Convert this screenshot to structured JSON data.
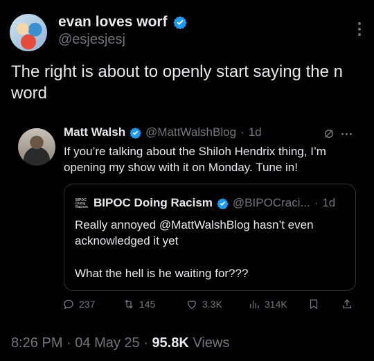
{
  "tweet": {
    "display_name": "evan loves worf",
    "handle": "@esjesjesj",
    "text": "The right is about to openly start saying the n word",
    "time": "8:26 PM",
    "date": "04 May 25",
    "views_count": "95.8K",
    "views_label": "Views"
  },
  "quoted": {
    "display_name": "Matt Walsh",
    "handle": "@MattWalshBlog",
    "age": "1d",
    "text": "If you’re talking about the Shiloh Hendrix thing, I’m opening my show with it on Monday. Tune in!",
    "nested": {
      "display_name": "BIPOC Doing Racism",
      "handle": "@BIPOCraci...",
      "age": "1d",
      "avatar_text": "BIPOC Doing Racism",
      "text_1": "Really annoyed @MattWalshBlog hasn’t even acknowledged it yet",
      "text_2": "What the hell is he waiting for???"
    },
    "stats": {
      "replies": "237",
      "reposts": "145",
      "likes": "3.3K",
      "views": "314K"
    }
  },
  "colors": {
    "background": "#000000",
    "text_primary": "#e7e9ea",
    "text_secondary": "#71767b",
    "verified": "#1d9bf0",
    "border": "#2f3336"
  },
  "icons": [
    "verified-icon",
    "more-icon",
    "grok-icon",
    "reply-icon",
    "repost-icon",
    "like-icon",
    "views-icon",
    "bookmark-icon",
    "share-icon"
  ]
}
